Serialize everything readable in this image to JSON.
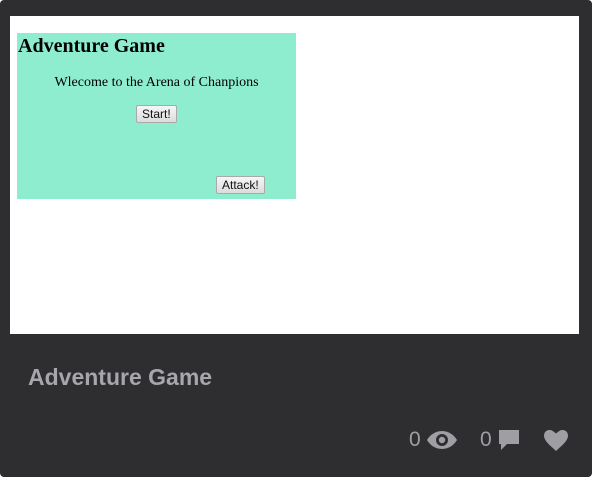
{
  "preview": {
    "game_title": "Adventure Game",
    "welcome_text": "Wlecome to the Arena of Chanpions",
    "start_label": "Start!",
    "attack_label": "Attack!",
    "game_background": "#8fedcf"
  },
  "card": {
    "title": "Adventure Game",
    "views_count": "0",
    "comments_count": "0",
    "views_icon": "eye-icon",
    "comments_icon": "comment-icon",
    "like_icon": "heart-icon",
    "background": "#2e2e31"
  }
}
